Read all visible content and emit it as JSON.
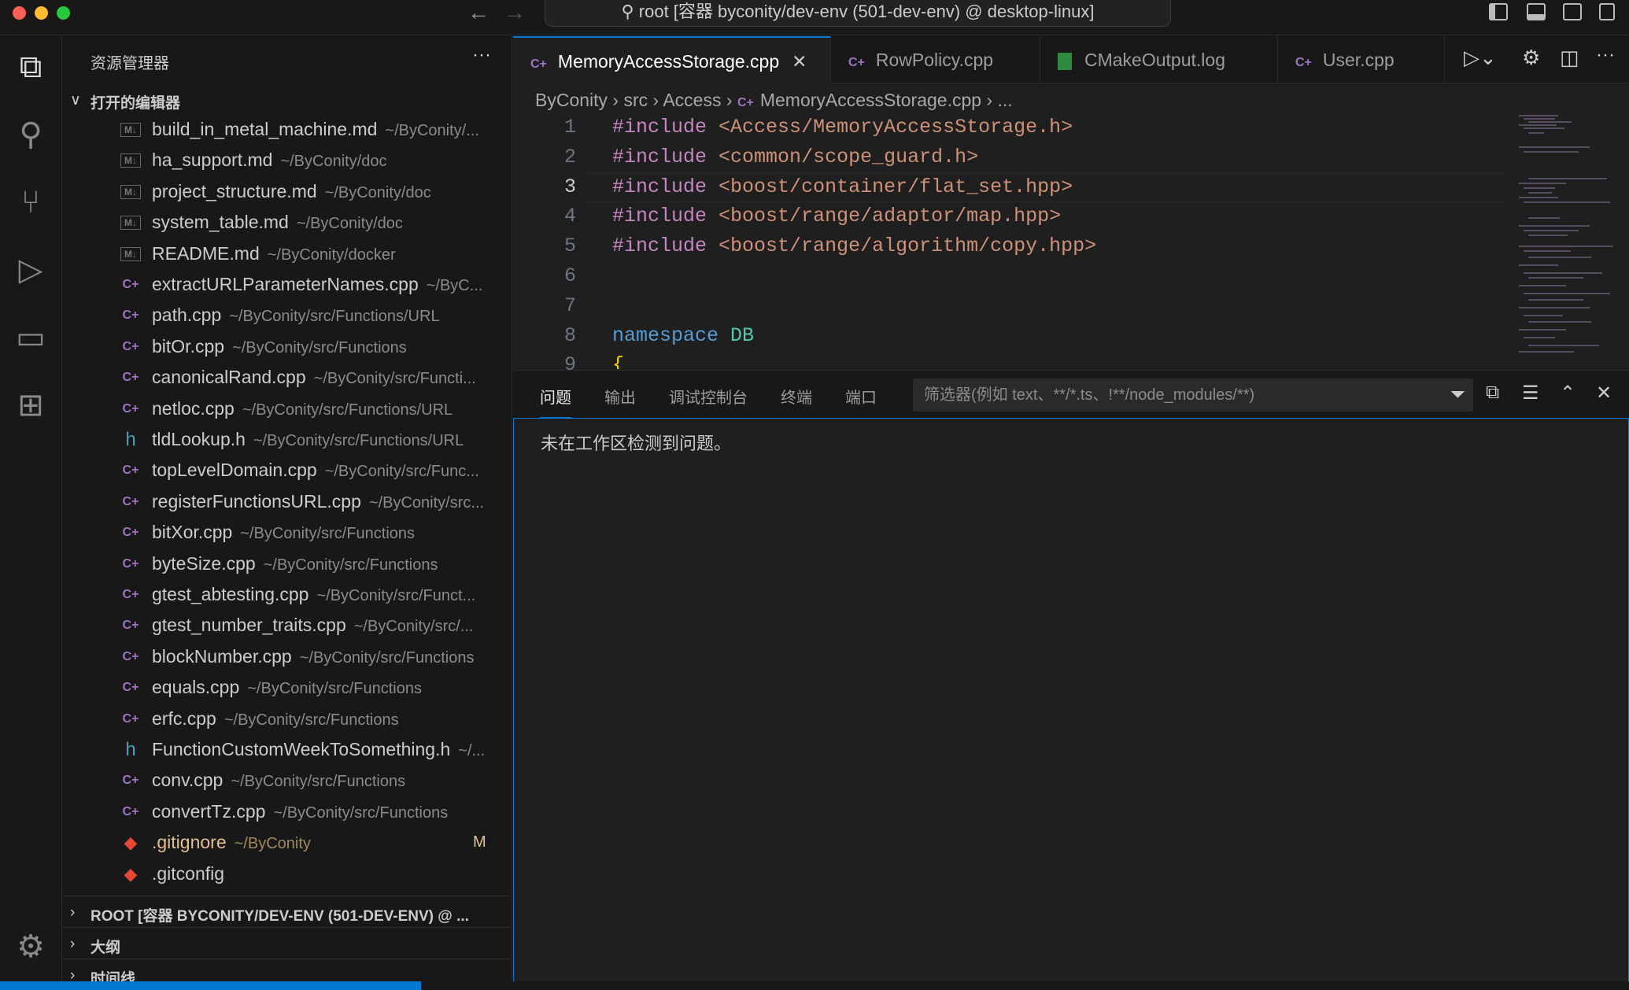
{
  "titlebar": {
    "command_center": "root [容器 byconity/dev-env (501-dev-env) @ desktop-linux]",
    "back_icon": "arrow-left-icon",
    "forward_icon": "arrow-right-icon"
  },
  "activity_bar": [
    "explorer-icon",
    "search-icon",
    "source-control-icon",
    "run-debug-icon",
    "remote-explorer-icon",
    "extensions-icon",
    "gear-icon"
  ],
  "sidebar": {
    "title": "资源管理器",
    "more": "···",
    "open_editors_label": "打开的编辑器",
    "files": [
      {
        "name": "build_in_metal_machine.md",
        "path": "~/ByConity/...",
        "type": "md"
      },
      {
        "name": "ha_support.md",
        "path": "~/ByConity/doc",
        "type": "md"
      },
      {
        "name": "project_structure.md",
        "path": "~/ByConity/doc",
        "type": "md"
      },
      {
        "name": "system_table.md",
        "path": "~/ByConity/doc",
        "type": "md"
      },
      {
        "name": "README.md",
        "path": "~/ByConity/docker",
        "type": "md"
      },
      {
        "name": "extractURLParameterNames.cpp",
        "path": "~/ByC...",
        "type": "cpp"
      },
      {
        "name": "path.cpp",
        "path": "~/ByConity/src/Functions/URL",
        "type": "cpp"
      },
      {
        "name": "bitOr.cpp",
        "path": "~/ByConity/src/Functions",
        "type": "cpp"
      },
      {
        "name": "canonicalRand.cpp",
        "path": "~/ByConity/src/Functi...",
        "type": "cpp"
      },
      {
        "name": "netloc.cpp",
        "path": "~/ByConity/src/Functions/URL",
        "type": "cpp"
      },
      {
        "name": "tldLookup.h",
        "path": "~/ByConity/src/Functions/URL",
        "type": "h"
      },
      {
        "name": "topLevelDomain.cpp",
        "path": "~/ByConity/src/Func...",
        "type": "cpp"
      },
      {
        "name": "registerFunctionsURL.cpp",
        "path": "~/ByConity/src...",
        "type": "cpp"
      },
      {
        "name": "bitXor.cpp",
        "path": "~/ByConity/src/Functions",
        "type": "cpp"
      },
      {
        "name": "byteSize.cpp",
        "path": "~/ByConity/src/Functions",
        "type": "cpp"
      },
      {
        "name": "gtest_abtesting.cpp",
        "path": "~/ByConity/src/Funct...",
        "type": "cpp"
      },
      {
        "name": "gtest_number_traits.cpp",
        "path": "~/ByConity/src/...",
        "type": "cpp"
      },
      {
        "name": "blockNumber.cpp",
        "path": "~/ByConity/src/Functions",
        "type": "cpp"
      },
      {
        "name": "equals.cpp",
        "path": "~/ByConity/src/Functions",
        "type": "cpp"
      },
      {
        "name": "erfc.cpp",
        "path": "~/ByConity/src/Functions",
        "type": "cpp"
      },
      {
        "name": "FunctionCustomWeekToSomething.h",
        "path": "~/...",
        "type": "h"
      },
      {
        "name": "conv.cpp",
        "path": "~/ByConity/src/Functions",
        "type": "cpp"
      },
      {
        "name": "convertTz.cpp",
        "path": "~/ByConity/src/Functions",
        "type": "cpp"
      },
      {
        "name": ".gitignore",
        "path": "~/ByConity",
        "type": "git",
        "badge": "M"
      },
      {
        "name": ".gitconfig",
        "path": "",
        "type": "git"
      }
    ],
    "sections": [
      "ROOT [容器 BYCONITY/DEV-ENV (501-DEV-ENV) @ ...",
      "大纲",
      "时间线"
    ]
  },
  "editor": {
    "tabs": [
      {
        "label": "MemoryAccessStorage.cpp",
        "icon": "cpp",
        "active": true
      },
      {
        "label": "RowPolicy.cpp",
        "icon": "cpp"
      },
      {
        "label": "CMakeOutput.log",
        "icon": "log"
      },
      {
        "label": "User.cpp",
        "icon": "cpp"
      }
    ],
    "breadcrumb": [
      "ByConity",
      "src",
      "Access",
      "MemoryAccessStorage.cpp",
      "..."
    ],
    "lines": [
      {
        "n": "1",
        "kw": "#include",
        "rest": "<Access/MemoryAccessStorage.h>"
      },
      {
        "n": "2",
        "kw": "#include",
        "rest": "<common/scope_guard.h>"
      },
      {
        "n": "3",
        "kw": "#include",
        "rest": "<boost/container/flat_set.hpp>"
      },
      {
        "n": "4",
        "kw": "#include",
        "rest": "<boost/range/adaptor/map.hpp>"
      },
      {
        "n": "5",
        "kw": "#include",
        "rest": "<boost/range/algorithm/copy.hpp>"
      },
      {
        "n": "6"
      },
      {
        "n": "7"
      },
      {
        "n": "8",
        "ns": "namespace",
        "ty": "DB"
      },
      {
        "n": "9",
        "br": "{"
      }
    ],
    "current_line": 3,
    "colors": {
      "keyword": "#c586c0",
      "string": "#ce9178",
      "namespace": "#569cd6",
      "type": "#4ec9b0",
      "accent": "#0078d4"
    }
  },
  "panel": {
    "tabs": [
      "问题",
      "输出",
      "调试控制台",
      "终端",
      "端口"
    ],
    "filter_placeholder": "筛选器(例如 text、**/*.ts、!**/node_modules/**)",
    "message": "未在工作区检测到问题。"
  }
}
